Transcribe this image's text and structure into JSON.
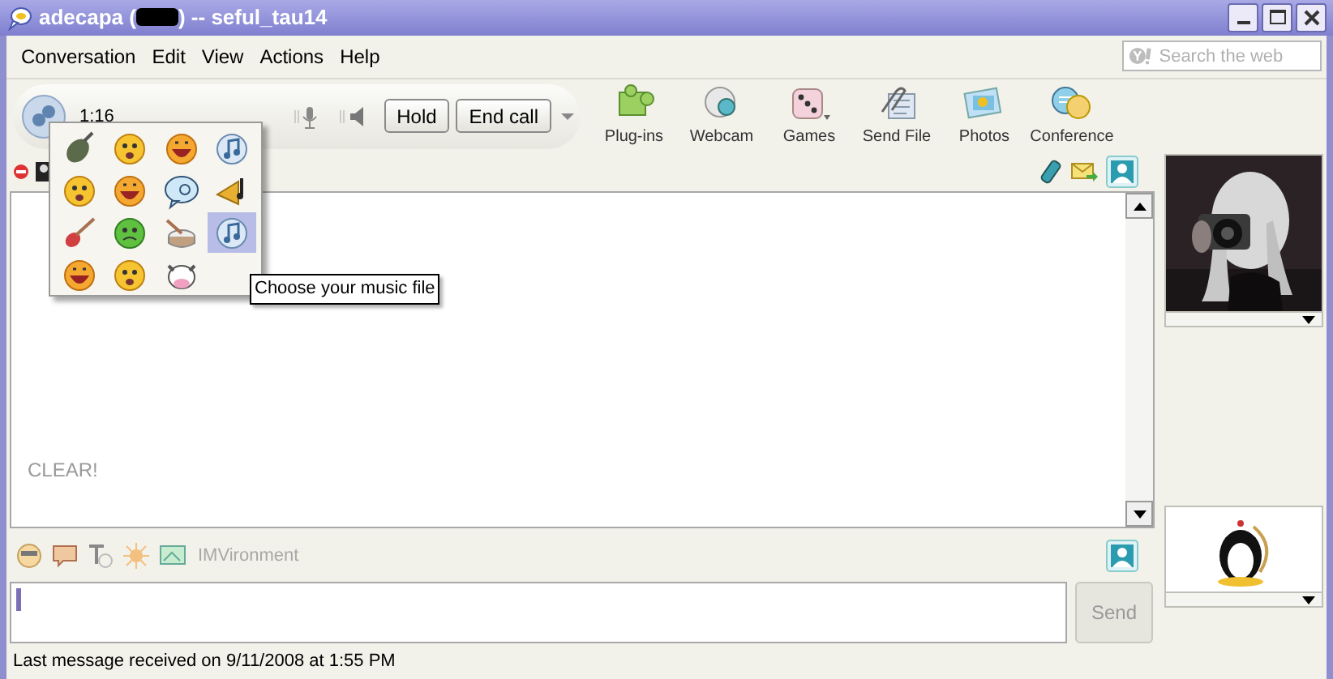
{
  "window": {
    "title_start": "adecapa (",
    "redacted": true,
    "title_end": ") -- seful_tau14"
  },
  "menu": [
    "Conversation",
    "Edit",
    "View",
    "Actions",
    "Help"
  ],
  "search": {
    "placeholder": "Search the web"
  },
  "call": {
    "timer": "1:16",
    "buttons": [
      "Hold",
      "End call"
    ]
  },
  "toolbar": [
    {
      "label": "Plug-ins"
    },
    {
      "label": "Webcam"
    },
    {
      "label": "Games"
    },
    {
      "label": "Send File"
    },
    {
      "label": "Photos"
    },
    {
      "label": "Conference"
    }
  ],
  "emoticon_picker": {
    "items": [
      {
        "kind": "bomb",
        "selected": false
      },
      {
        "kind": "smiley",
        "selected": false
      },
      {
        "kind": "laugh",
        "selected": false
      },
      {
        "kind": "music",
        "selected": false
      },
      {
        "kind": "smiley",
        "selected": false
      },
      {
        "kind": "laugh",
        "selected": false
      },
      {
        "kind": "bubble",
        "selected": false
      },
      {
        "kind": "horn",
        "selected": false
      },
      {
        "kind": "guitar",
        "selected": false
      },
      {
        "kind": "sick",
        "selected": false
      },
      {
        "kind": "drum",
        "selected": false
      },
      {
        "kind": "music",
        "selected": true
      },
      {
        "kind": "laugh",
        "selected": false
      },
      {
        "kind": "smiley",
        "selected": false
      },
      {
        "kind": "cow",
        "selected": false
      }
    ]
  },
  "tooltip": "Choose your music file",
  "conversation": {
    "messages": [
      "CLEAR!"
    ]
  },
  "format_bar": {
    "imvironment": "IMVironment"
  },
  "send_button": {
    "label": "Send",
    "disabled": true
  },
  "status_bar": "Last message received on 9/11/2008 at 1:55 PM"
}
